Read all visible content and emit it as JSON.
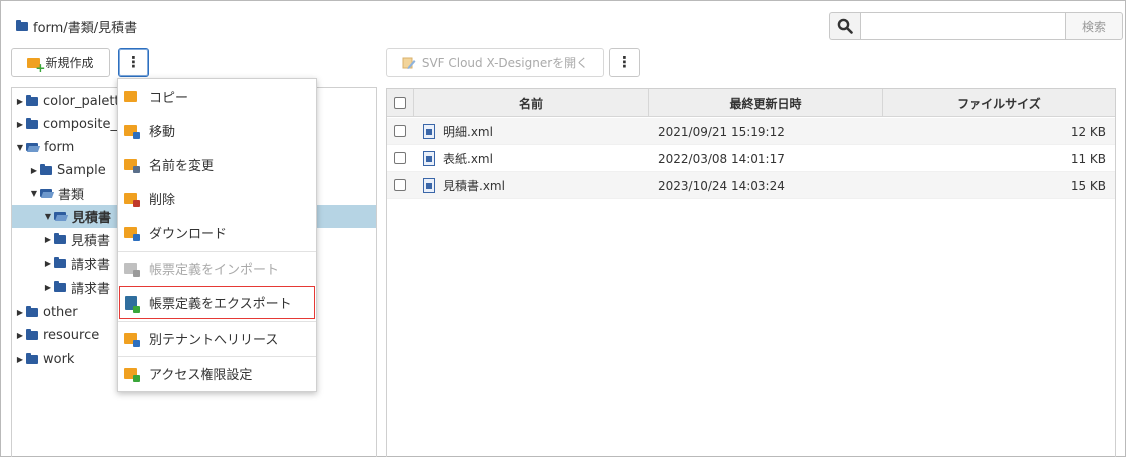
{
  "breadcrumb": {
    "path": "form/書類/見積書",
    "icon": "folder-icon"
  },
  "search": {
    "placeholder": "",
    "button_label": "検索",
    "icon": "search-icon"
  },
  "left_toolbar": {
    "new_label": "新規作成",
    "more_icon": "kebab-icon"
  },
  "right_toolbar": {
    "svf_label": "SVF Cloud X-Designerを開く",
    "more_icon": "kebab-icon"
  },
  "tree": [
    {
      "label": "color_palett",
      "toggle": "▶",
      "expanded": false
    },
    {
      "label": "composite_",
      "toggle": "▶",
      "expanded": false
    },
    {
      "label": "form",
      "toggle": "▼",
      "expanded": true
    },
    {
      "label": "Sample",
      "toggle": "▶",
      "expanded": false
    },
    {
      "label": "書類",
      "toggle": "▼",
      "expanded": true
    },
    {
      "label": "見積書",
      "toggle": "▼",
      "expanded": true,
      "selected": true
    },
    {
      "label": "見積書",
      "toggle": "▶",
      "expanded": false
    },
    {
      "label": "請求書",
      "toggle": "▶",
      "expanded": false
    },
    {
      "label": "請求書",
      "toggle": "▶",
      "expanded": false
    },
    {
      "label": "other",
      "toggle": "▶",
      "expanded": false
    },
    {
      "label": "resource",
      "toggle": "▶",
      "expanded": false
    },
    {
      "label": "work",
      "toggle": "▶",
      "expanded": false
    }
  ],
  "menu": [
    {
      "label": "コピー",
      "icon": "copy-folder-icon",
      "disabled": false
    },
    {
      "label": "移動",
      "icon": "move-folder-icon",
      "disabled": false
    },
    {
      "label": "名前を変更",
      "icon": "rename-folder-icon",
      "disabled": false
    },
    {
      "label": "削除",
      "icon": "delete-folder-icon",
      "disabled": false
    },
    {
      "label": "ダウンロード",
      "icon": "download-folder-icon",
      "disabled": false
    },
    {
      "label": "帳票定義をインポート",
      "icon": "import-folder-icon",
      "disabled": true
    },
    {
      "label": "帳票定義をエクスポート",
      "icon": "export-document-icon",
      "disabled": false,
      "highlighted": true
    },
    {
      "label": "別テナントへリリース",
      "icon": "release-folder-icon",
      "disabled": false
    },
    {
      "label": "アクセス権限設定",
      "icon": "access-lock-folder-icon",
      "disabled": false
    }
  ],
  "table": {
    "columns": [
      "名前",
      "最終更新日時",
      "ファイルサイズ"
    ],
    "rows": [
      {
        "name": "明細.xml",
        "modified": "2021/09/21 15:19:12",
        "size": "12 KB"
      },
      {
        "name": "表紙.xml",
        "modified": "2022/03/08 14:01:17",
        "size": "11 KB"
      },
      {
        "name": "見積書.xml",
        "modified": "2023/10/24 14:03:24",
        "size": "15 KB"
      }
    ]
  },
  "colors": {
    "selection": "#b6d4e4",
    "folder": "#2d5c9e",
    "accent_orange": "#f0a020",
    "highlight_border": "#e53935"
  }
}
